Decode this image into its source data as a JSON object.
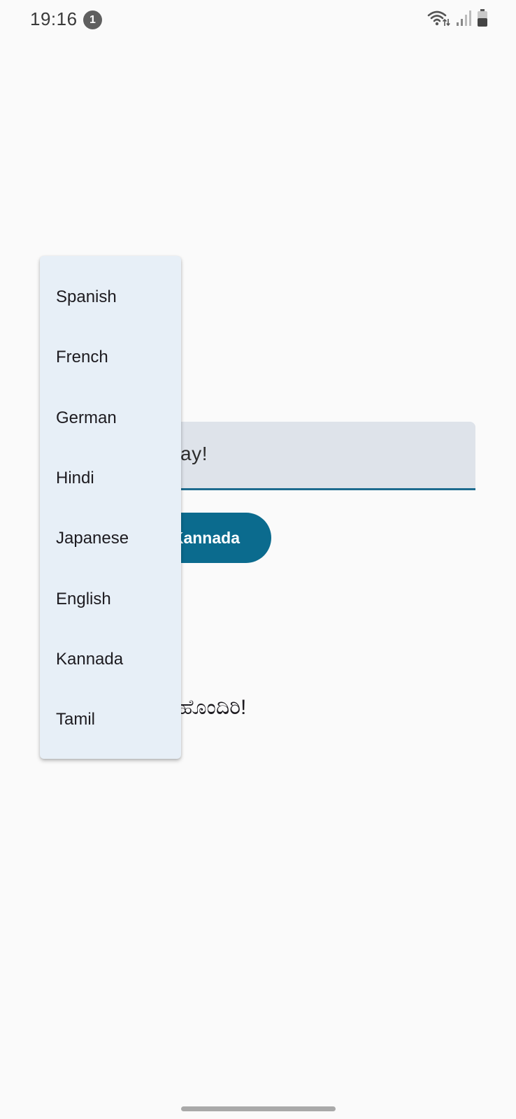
{
  "status_bar": {
    "time": "19:16",
    "notification_count": "1",
    "icons": [
      "wifi-icon",
      "signal-icon",
      "battery-icon"
    ]
  },
  "input": {
    "value": "Have a nice day!"
  },
  "translate_button": {
    "label": "Translate to Kannada"
  },
  "result": {
    "text": "ಒಳ್ಳೆಯ ದಿನ ಹೊಂದಿರಿ!"
  },
  "language_menu": {
    "items": [
      {
        "label": "Spanish"
      },
      {
        "label": "French"
      },
      {
        "label": "German"
      },
      {
        "label": "Hindi"
      },
      {
        "label": "Japanese"
      },
      {
        "label": "English"
      },
      {
        "label": "Kannada"
      },
      {
        "label": "Tamil"
      }
    ]
  },
  "colors": {
    "background": "#fafafa",
    "primary": "#0b6b8e",
    "field_fill": "#dee3ea",
    "menu_fill": "#e7eff7"
  }
}
